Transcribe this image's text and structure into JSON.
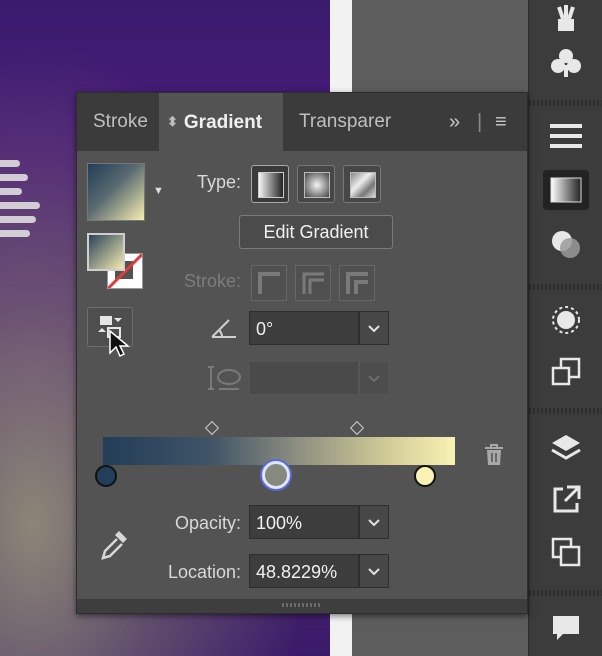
{
  "panel": {
    "tabs": [
      {
        "label": "Stroke",
        "active": false
      },
      {
        "label": "Gradient",
        "active": true
      },
      {
        "label": "Transparer",
        "active": false
      }
    ],
    "menu_icons": [
      "double-chevron-icon",
      "hamburger-menu-icon"
    ]
  },
  "gradient": {
    "type_label": "Type:",
    "type_options": [
      "linear",
      "radial",
      "freeform"
    ],
    "selected_type": "linear",
    "edit_label": "Edit Gradient",
    "stroke_label": "Stroke:",
    "angle_value": "0°",
    "aspect_value": "",
    "opacity_label": "Opacity:",
    "opacity_value": "100%",
    "location_label": "Location:",
    "location_value": "48.8229%",
    "colors": {
      "start": "#223e58",
      "end": "#f8f2b4"
    },
    "stops": [
      {
        "location_percent": 0,
        "color": "#223e58"
      },
      {
        "location_percent": 48.8229,
        "color": "#8c8e80",
        "selected": true
      },
      {
        "location_percent": 100,
        "color": "#f8f2b4"
      }
    ],
    "midpoints_percent": [
      30,
      72
    ]
  },
  "dock": {
    "icons": [
      "plant-icon",
      "club-icon",
      "stroke-lines-icon",
      "gradient-icon",
      "transparency-icon",
      "appearance-icon",
      "graphic-styles-icon",
      "layers-icon",
      "export-icon",
      "artboards-icon",
      "comment-icon"
    ],
    "active": "gradient-icon"
  }
}
